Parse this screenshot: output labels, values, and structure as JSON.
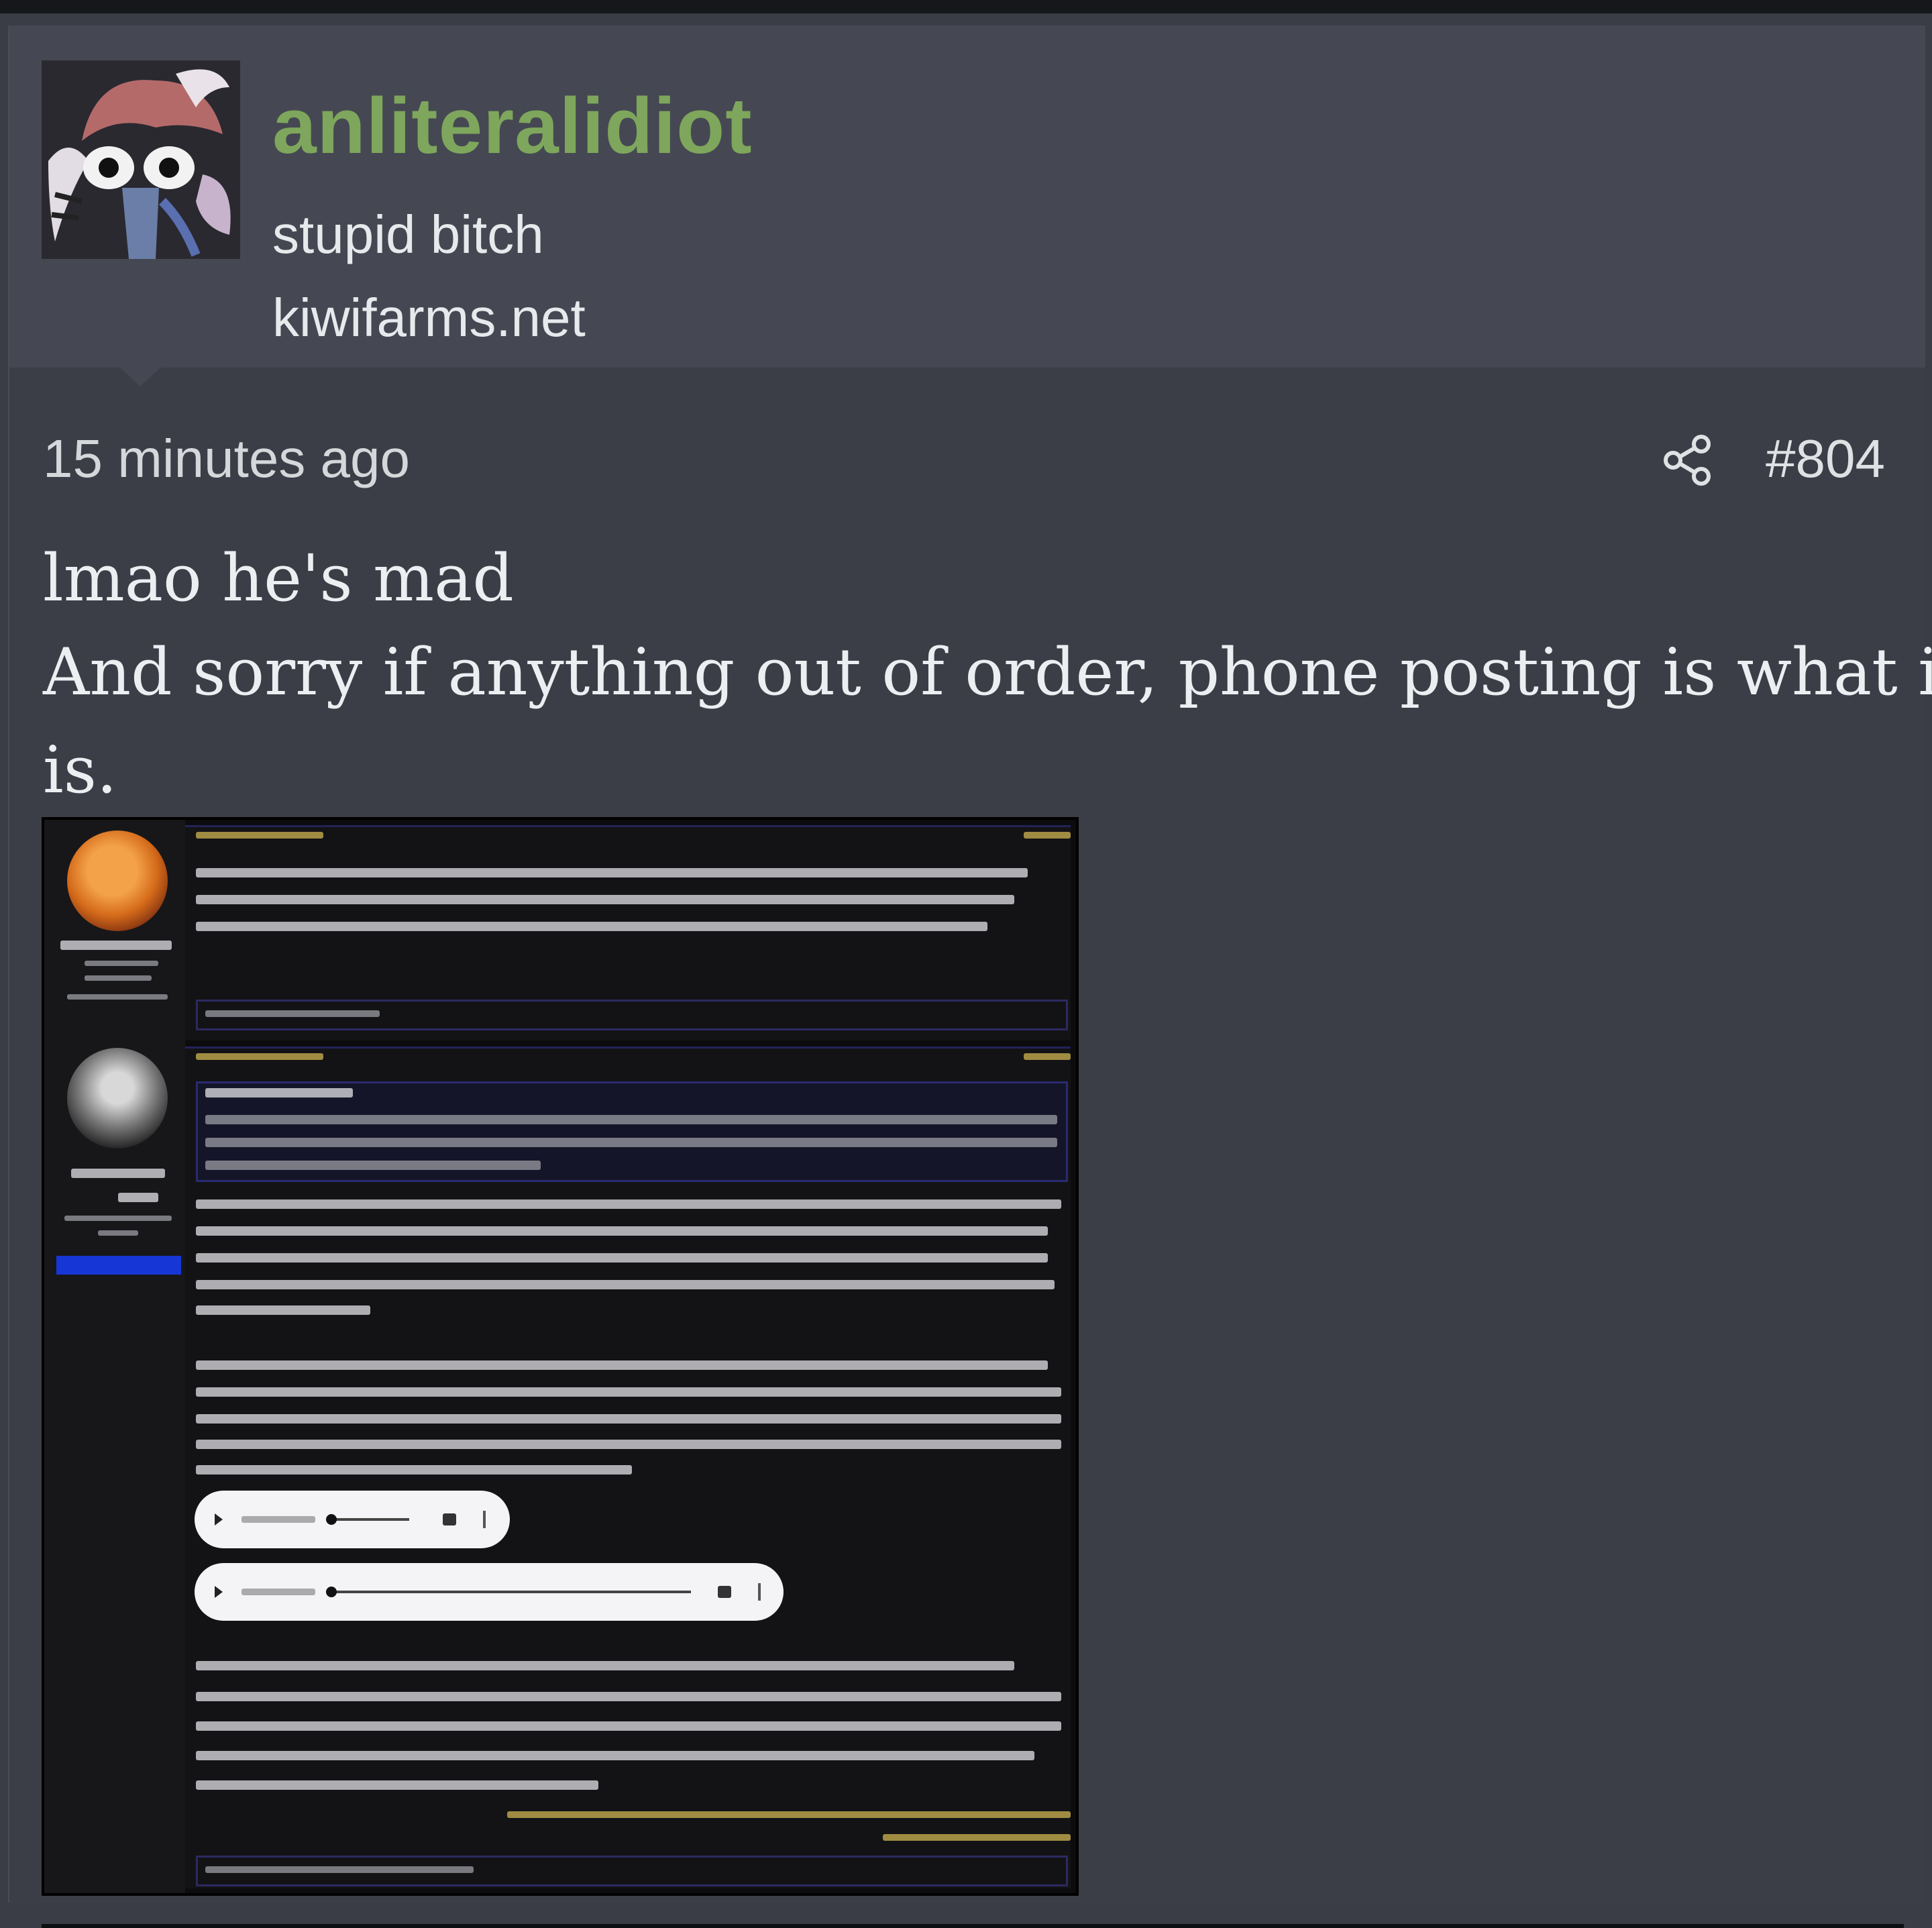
{
  "user": {
    "username": "anliteralidiot",
    "title": "stupid bitch",
    "site": "kiwifarms.net"
  },
  "post": {
    "time": "15 minutes ago",
    "number": "#804",
    "body_line1": "lmao he's mad",
    "body_line2": "And sorry if anything out of order, phone posting is what it",
    "body_line3": "is."
  },
  "icons": {
    "share": "share-icon",
    "avatar": "clown-avatar-image"
  },
  "colors": {
    "username": "#7ea65c",
    "background": "#3b3e47",
    "user_block": "#454852"
  }
}
